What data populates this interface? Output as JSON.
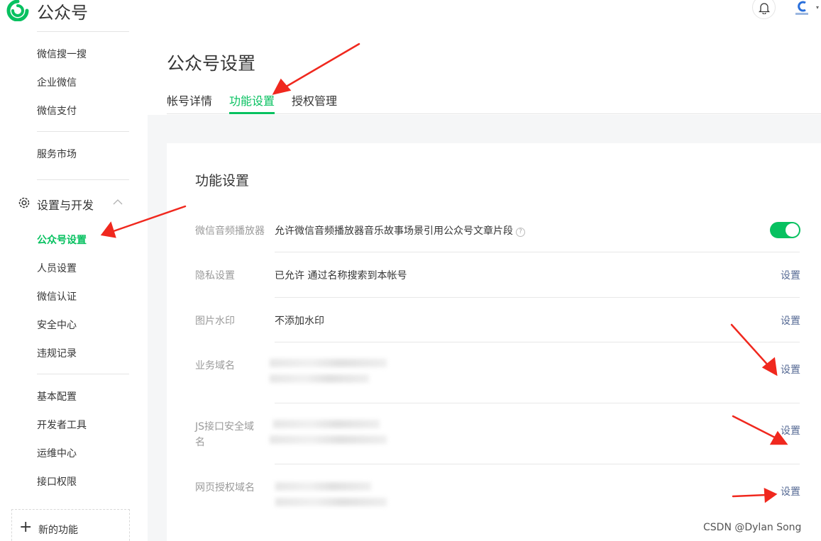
{
  "header": {
    "brand": "公众号",
    "icons": [
      "wechat-mp-logo-icon",
      "bell-icon",
      "avatar-icon"
    ],
    "brand_color": "#07c160"
  },
  "sidebar": {
    "items_top": [
      "微信搜一搜",
      "企业微信",
      "微信支付"
    ],
    "service_market": "服务市场",
    "group": {
      "label": "设置与开发",
      "icon": "gear-icon",
      "expanded": true
    },
    "sub_items": [
      "公众号设置",
      "人员设置",
      "微信认证",
      "安全中心",
      "违规记录"
    ],
    "active_item": "公众号设置",
    "dev_items": [
      "基本配置",
      "开发者工具",
      "运维中心",
      "接口权限"
    ],
    "new_feature": "新的功能"
  },
  "page": {
    "title": "公众号设置",
    "tabs": [
      "帐号详情",
      "功能设置",
      "授权管理"
    ],
    "active_tab": "功能设置"
  },
  "card": {
    "title": "功能设置",
    "rows": [
      {
        "label": "微信音频播放器",
        "value": "允许微信音频播放器音乐故事场景引用公众号文章片段",
        "control": "toggle",
        "enabled": true
      },
      {
        "label": "隐私设置",
        "value": "已允许 通过名称搜索到本帐号",
        "action": "设置"
      },
      {
        "label": "图片水印",
        "value": "不添加水印",
        "action": "设置"
      },
      {
        "label": "业务域名",
        "value": "",
        "action": "设置"
      },
      {
        "label_line1": "JS接口安全域",
        "label_line2": "名",
        "value": "",
        "action": "设置"
      },
      {
        "label": "网页授权域名",
        "value": "",
        "action": "设置"
      }
    ]
  },
  "annotations": {
    "arrow_color": "#f0281e"
  },
  "watermark": "CSDN @Dylan  Song"
}
